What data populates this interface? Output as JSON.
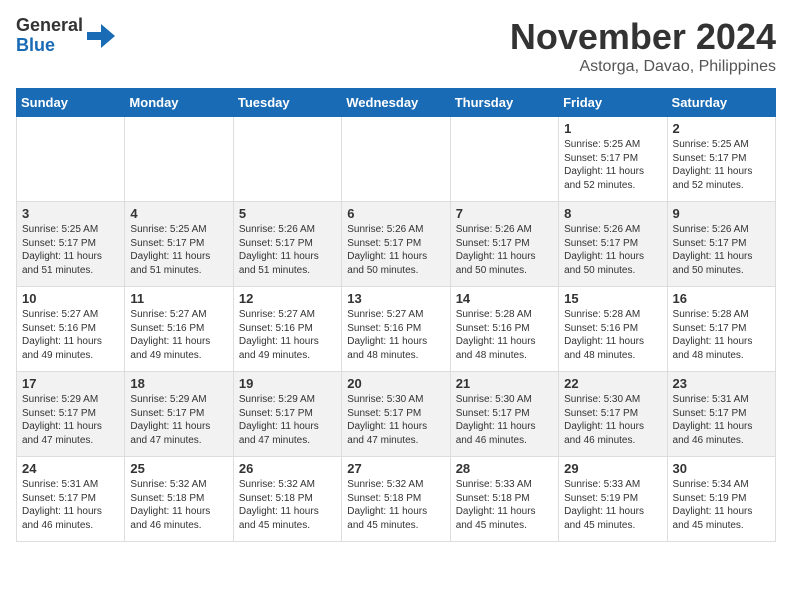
{
  "header": {
    "logo_general": "General",
    "logo_blue": "Blue",
    "month_title": "November 2024",
    "location": "Astorga, Davao, Philippines"
  },
  "weekdays": [
    "Sunday",
    "Monday",
    "Tuesday",
    "Wednesday",
    "Thursday",
    "Friday",
    "Saturday"
  ],
  "weeks": [
    [
      {
        "day": "",
        "content": ""
      },
      {
        "day": "",
        "content": ""
      },
      {
        "day": "",
        "content": ""
      },
      {
        "day": "",
        "content": ""
      },
      {
        "day": "",
        "content": ""
      },
      {
        "day": "1",
        "content": "Sunrise: 5:25 AM\nSunset: 5:17 PM\nDaylight: 11 hours\nand 52 minutes."
      },
      {
        "day": "2",
        "content": "Sunrise: 5:25 AM\nSunset: 5:17 PM\nDaylight: 11 hours\nand 52 minutes."
      }
    ],
    [
      {
        "day": "3",
        "content": "Sunrise: 5:25 AM\nSunset: 5:17 PM\nDaylight: 11 hours\nand 51 minutes."
      },
      {
        "day": "4",
        "content": "Sunrise: 5:25 AM\nSunset: 5:17 PM\nDaylight: 11 hours\nand 51 minutes."
      },
      {
        "day": "5",
        "content": "Sunrise: 5:26 AM\nSunset: 5:17 PM\nDaylight: 11 hours\nand 51 minutes."
      },
      {
        "day": "6",
        "content": "Sunrise: 5:26 AM\nSunset: 5:17 PM\nDaylight: 11 hours\nand 50 minutes."
      },
      {
        "day": "7",
        "content": "Sunrise: 5:26 AM\nSunset: 5:17 PM\nDaylight: 11 hours\nand 50 minutes."
      },
      {
        "day": "8",
        "content": "Sunrise: 5:26 AM\nSunset: 5:17 PM\nDaylight: 11 hours\nand 50 minutes."
      },
      {
        "day": "9",
        "content": "Sunrise: 5:26 AM\nSunset: 5:17 PM\nDaylight: 11 hours\nand 50 minutes."
      }
    ],
    [
      {
        "day": "10",
        "content": "Sunrise: 5:27 AM\nSunset: 5:16 PM\nDaylight: 11 hours\nand 49 minutes."
      },
      {
        "day": "11",
        "content": "Sunrise: 5:27 AM\nSunset: 5:16 PM\nDaylight: 11 hours\nand 49 minutes."
      },
      {
        "day": "12",
        "content": "Sunrise: 5:27 AM\nSunset: 5:16 PM\nDaylight: 11 hours\nand 49 minutes."
      },
      {
        "day": "13",
        "content": "Sunrise: 5:27 AM\nSunset: 5:16 PM\nDaylight: 11 hours\nand 48 minutes."
      },
      {
        "day": "14",
        "content": "Sunrise: 5:28 AM\nSunset: 5:16 PM\nDaylight: 11 hours\nand 48 minutes."
      },
      {
        "day": "15",
        "content": "Sunrise: 5:28 AM\nSunset: 5:16 PM\nDaylight: 11 hours\nand 48 minutes."
      },
      {
        "day": "16",
        "content": "Sunrise: 5:28 AM\nSunset: 5:17 PM\nDaylight: 11 hours\nand 48 minutes."
      }
    ],
    [
      {
        "day": "17",
        "content": "Sunrise: 5:29 AM\nSunset: 5:17 PM\nDaylight: 11 hours\nand 47 minutes."
      },
      {
        "day": "18",
        "content": "Sunrise: 5:29 AM\nSunset: 5:17 PM\nDaylight: 11 hours\nand 47 minutes."
      },
      {
        "day": "19",
        "content": "Sunrise: 5:29 AM\nSunset: 5:17 PM\nDaylight: 11 hours\nand 47 minutes."
      },
      {
        "day": "20",
        "content": "Sunrise: 5:30 AM\nSunset: 5:17 PM\nDaylight: 11 hours\nand 47 minutes."
      },
      {
        "day": "21",
        "content": "Sunrise: 5:30 AM\nSunset: 5:17 PM\nDaylight: 11 hours\nand 46 minutes."
      },
      {
        "day": "22",
        "content": "Sunrise: 5:30 AM\nSunset: 5:17 PM\nDaylight: 11 hours\nand 46 minutes."
      },
      {
        "day": "23",
        "content": "Sunrise: 5:31 AM\nSunset: 5:17 PM\nDaylight: 11 hours\nand 46 minutes."
      }
    ],
    [
      {
        "day": "24",
        "content": "Sunrise: 5:31 AM\nSunset: 5:17 PM\nDaylight: 11 hours\nand 46 minutes."
      },
      {
        "day": "25",
        "content": "Sunrise: 5:32 AM\nSunset: 5:18 PM\nDaylight: 11 hours\nand 46 minutes."
      },
      {
        "day": "26",
        "content": "Sunrise: 5:32 AM\nSunset: 5:18 PM\nDaylight: 11 hours\nand 45 minutes."
      },
      {
        "day": "27",
        "content": "Sunrise: 5:32 AM\nSunset: 5:18 PM\nDaylight: 11 hours\nand 45 minutes."
      },
      {
        "day": "28",
        "content": "Sunrise: 5:33 AM\nSunset: 5:18 PM\nDaylight: 11 hours\nand 45 minutes."
      },
      {
        "day": "29",
        "content": "Sunrise: 5:33 AM\nSunset: 5:19 PM\nDaylight: 11 hours\nand 45 minutes."
      },
      {
        "day": "30",
        "content": "Sunrise: 5:34 AM\nSunset: 5:19 PM\nDaylight: 11 hours\nand 45 minutes."
      }
    ]
  ]
}
